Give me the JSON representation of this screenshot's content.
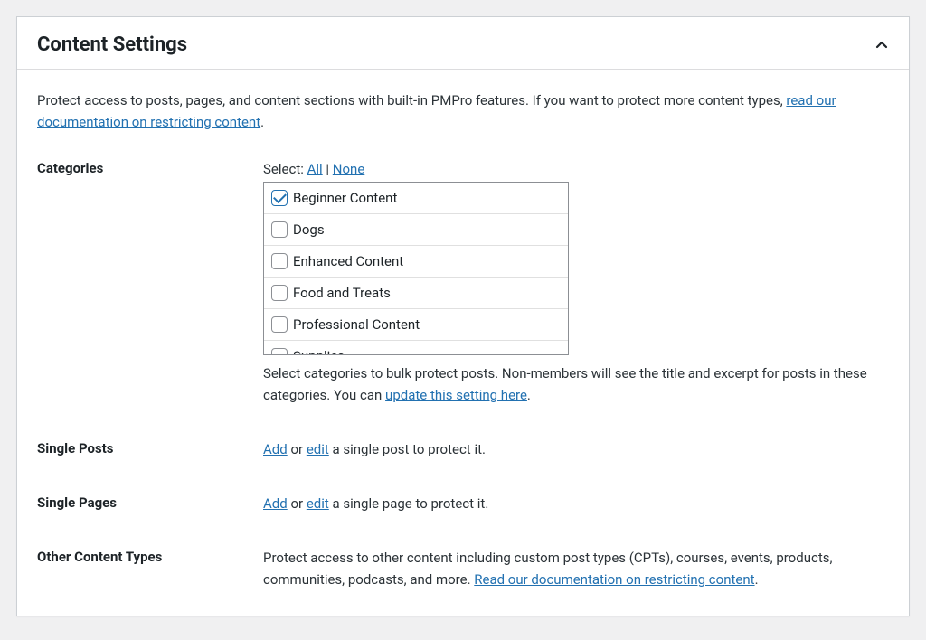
{
  "panel": {
    "title": "Content Settings"
  },
  "intro": {
    "text_before": "Protect access to posts, pages, and content sections with built-in PMPro features. If you want to protect more content types, ",
    "link": "read our documentation on restricting content",
    "text_after": "."
  },
  "categories": {
    "label": "Categories",
    "select_prefix": "Select: ",
    "all": "All",
    "sep": " | ",
    "none": "None",
    "items": [
      {
        "label": "Beginner Content",
        "checked": true
      },
      {
        "label": "Dogs",
        "checked": false
      },
      {
        "label": "Enhanced Content",
        "checked": false
      },
      {
        "label": "Food and Treats",
        "checked": false
      },
      {
        "label": "Professional Content",
        "checked": false
      },
      {
        "label": "Supplies",
        "checked": false
      }
    ],
    "helper_before": "Select categories to bulk protect posts. Non-members will see the title and excerpt for posts in these categories. You can ",
    "helper_link": "update this setting here",
    "helper_after": "."
  },
  "single_posts": {
    "label": "Single Posts",
    "add": "Add",
    "mid1": " or ",
    "edit": "edit",
    "tail": " a single post to protect it."
  },
  "single_pages": {
    "label": "Single Pages",
    "add": "Add",
    "mid1": " or ",
    "edit": "edit",
    "tail": " a single page to protect it."
  },
  "other": {
    "label": "Other Content Types",
    "text_before": "Protect access to other content including custom post types (CPTs), courses, events, products, communities, podcasts, and more. ",
    "link": "Read our documentation on restricting content",
    "text_after": "."
  }
}
